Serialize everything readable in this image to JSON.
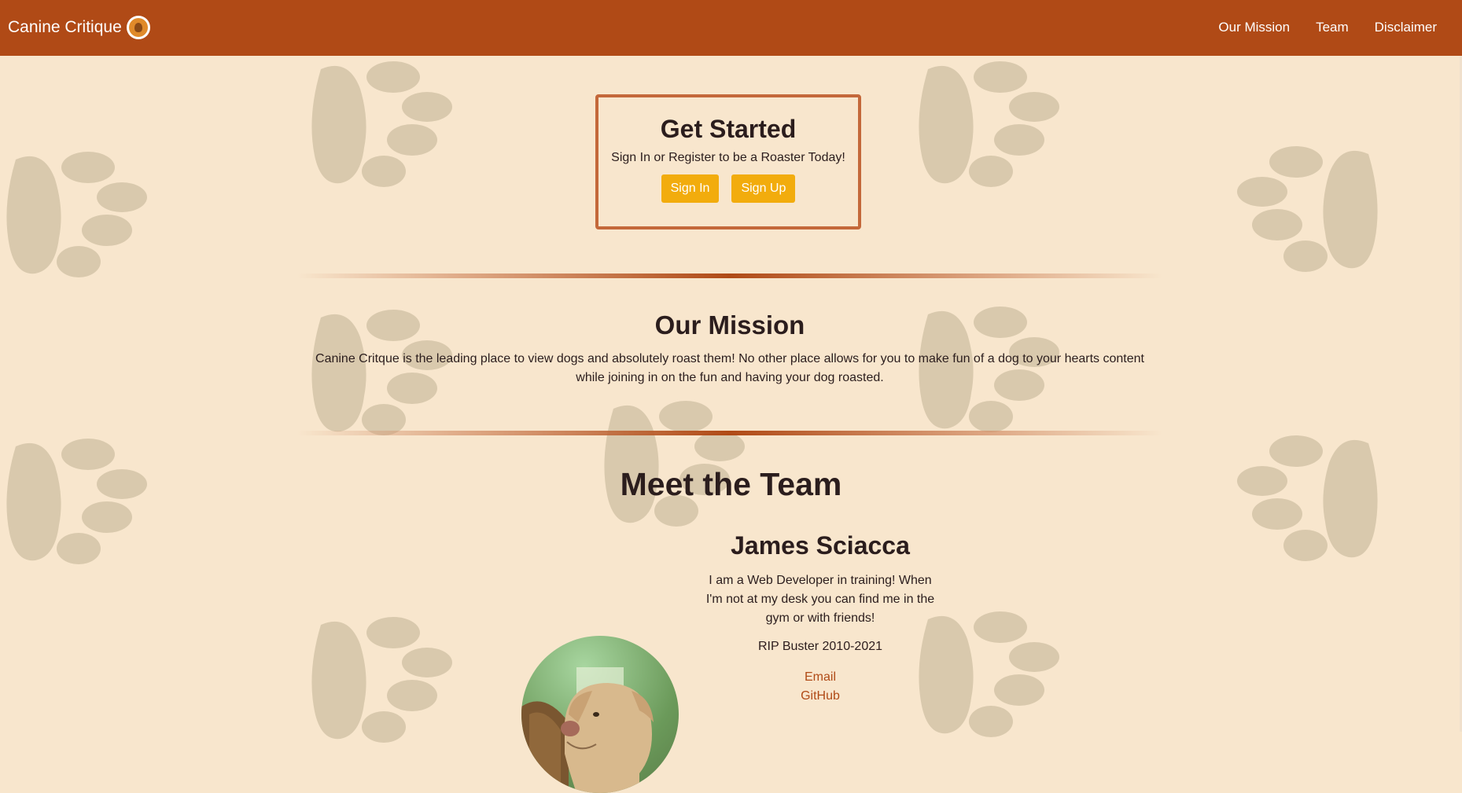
{
  "brand": {
    "name": "Canine Critique",
    "logo_icon": "dog-logo-icon"
  },
  "nav": {
    "links": [
      "Our Mission",
      "Team",
      "Disclaimer"
    ]
  },
  "get_started": {
    "title": "Get Started",
    "subtitle": "Sign In or Register to be a Roaster Today!",
    "sign_in_label": "Sign In",
    "sign_up_label": "Sign Up"
  },
  "mission": {
    "title": "Our Mission",
    "text": "Canine Critque is the leading place to view dogs and absolutely roast them! No other place allows for you to make fun of a dog to your hearts content while joining in on the fun and having your dog roasted."
  },
  "team": {
    "title": "Meet the Team",
    "members": [
      {
        "name": "James Sciacca",
        "bio": "I am a Web Developer in training! When I'm not at my desk you can find me in the gym or with friends!",
        "rip": "RIP Buster 2010-2021",
        "email_label": "Email",
        "github_label": "GitHub"
      }
    ]
  },
  "colors": {
    "navbar": "#b04a16",
    "background": "#f8e6cd",
    "button": "#f2ac0d",
    "link": "#b04a16",
    "card_border": "#c4683a",
    "paw": "#d9c9ad"
  }
}
